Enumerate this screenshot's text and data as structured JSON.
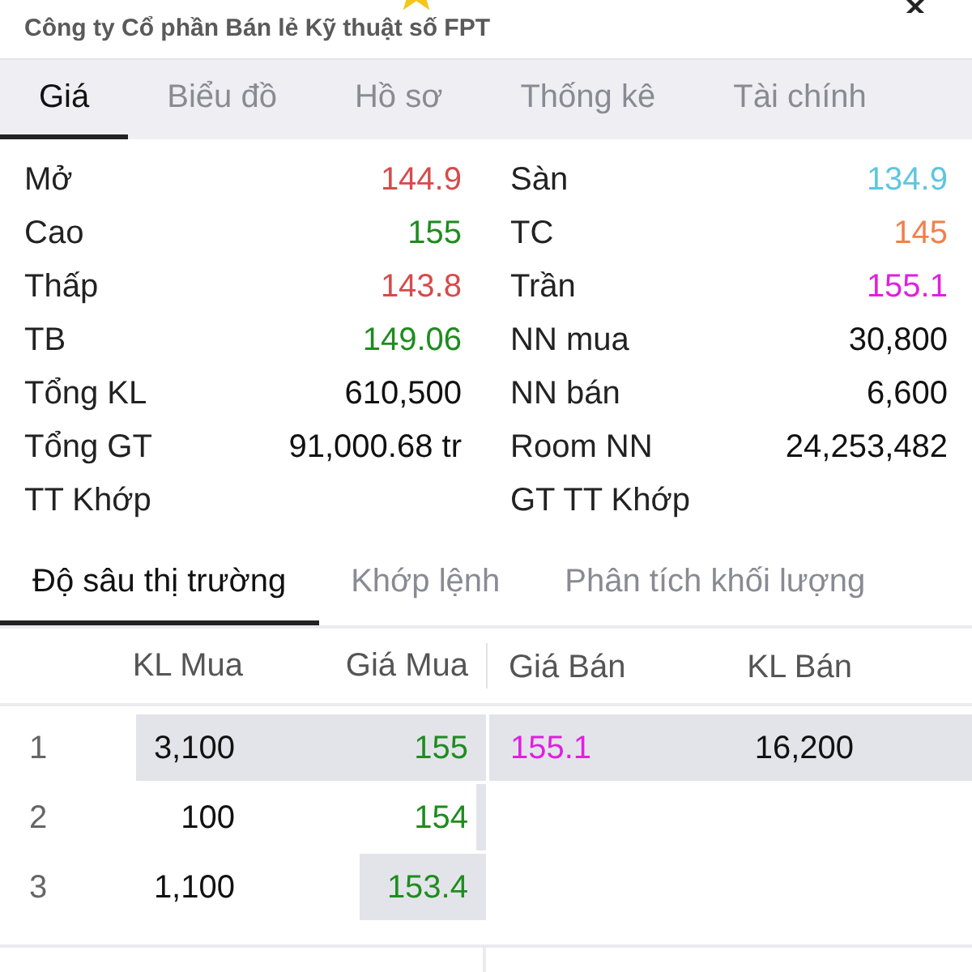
{
  "header": {
    "company_name": "Công ty Cổ phần Bán lẻ Kỹ thuật số FPT"
  },
  "tabs": [
    {
      "label": "Giá",
      "selected": true
    },
    {
      "label": "Biểu đồ",
      "selected": false
    },
    {
      "label": "Hồ sơ",
      "selected": false
    },
    {
      "label": "Thống kê",
      "selected": false
    },
    {
      "label": "Tài chính",
      "selected": false
    }
  ],
  "quote": {
    "left": [
      {
        "label": "Mở",
        "value": "144.9",
        "color": "#d64b4b"
      },
      {
        "label": "Cao",
        "value": "155",
        "color": "#1e8c1e"
      },
      {
        "label": "Thấp",
        "value": "143.8",
        "color": "#d64b4b"
      },
      {
        "label": "TB",
        "value": "149.06",
        "color": "#1e8c1e"
      },
      {
        "label": "Tổng KL",
        "value": "610,500"
      },
      {
        "label": "Tổng GT",
        "value": "91,000.68 tr"
      },
      {
        "label": "TT Khớp"
      }
    ],
    "right": [
      {
        "label": "Sàn",
        "value": "134.9",
        "color": "#5cc6e0"
      },
      {
        "label": "TC",
        "value": "145",
        "color": "#f0804a"
      },
      {
        "label": "Trần",
        "value": "155.1",
        "color": "#e020e0"
      },
      {
        "label": "NN mua",
        "value": "30,800"
      },
      {
        "label": "NN bán",
        "value": "6,600"
      },
      {
        "label": "Room NN",
        "value": "24,253,482"
      },
      {
        "label": "GT TT Khớp"
      }
    ]
  },
  "depth_tabs": [
    {
      "label": "Độ sâu thị trường",
      "selected": true
    },
    {
      "label": "Khớp lệnh",
      "selected": false
    },
    {
      "label": "Phân tích khối lượng",
      "selected": false
    }
  ],
  "depth_table": {
    "columns": [
      "KL Mua",
      "Giá Mua",
      "Giá Bán",
      "KL Bán"
    ],
    "rows": [
      {
        "index": "1",
        "buy": {
          "volume": "3,100",
          "price": "155",
          "color": "#1e8c1e",
          "level": 0.72
        },
        "sell": {
          "price": "155.1",
          "volume": "16,200",
          "color": "#e020e0",
          "level": 1
        }
      },
      {
        "index": "2",
        "buy": {
          "volume": "100",
          "price": "154",
          "color": "#1e8c1e",
          "level": 0.02
        }
      },
      {
        "index": "3",
        "buy": {
          "volume": "1,100",
          "price": "153.4",
          "color": "#1e8c1e",
          "level": 0.26
        }
      }
    ]
  }
}
